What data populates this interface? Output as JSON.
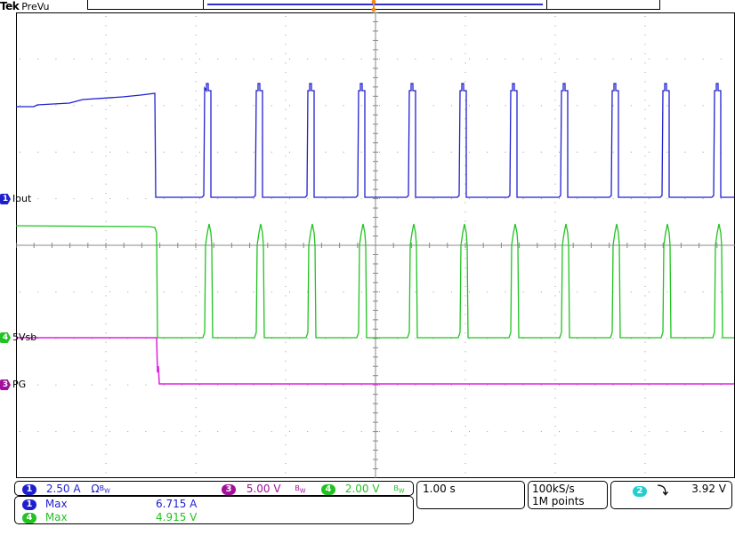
{
  "header": {
    "brand": "Tek",
    "mode": "PreVu"
  },
  "colors": {
    "ch1": "#1f1fd0",
    "ch2": "#22cfcf",
    "ch3": "#a0109a",
    "ch4": "#21c321",
    "ch3_trace": "#e21ee0",
    "grid": "#9a9a9a",
    "trigger": "#f08a1c"
  },
  "channels": {
    "ch1": {
      "number": "1",
      "label": "Iout",
      "scale": "2.50 A",
      "coupling": "Ω",
      "bw": "B",
      "bw_sub": "W"
    },
    "ch3": {
      "number": "3",
      "label": "PG",
      "scale": "5.00 V",
      "bw": "B",
      "bw_sub": "W"
    },
    "ch4": {
      "number": "4",
      "label": "5Vsb",
      "scale": "2.00 V",
      "bw": "B",
      "bw_sub": "W"
    }
  },
  "timebase": {
    "scale": "1.00 s",
    "sample_rate": "100kS/s",
    "record_length": "1M points"
  },
  "trigger": {
    "source": "2",
    "slope_symbol": "⤵",
    "level": "3.92 V"
  },
  "measurements": [
    {
      "source": "1",
      "name": "Max",
      "value": "6.715 A",
      "color": "#1f1fd0"
    },
    {
      "source": "4",
      "name": "Max",
      "value": "4.915 V",
      "color": "#21c321"
    }
  ]
}
